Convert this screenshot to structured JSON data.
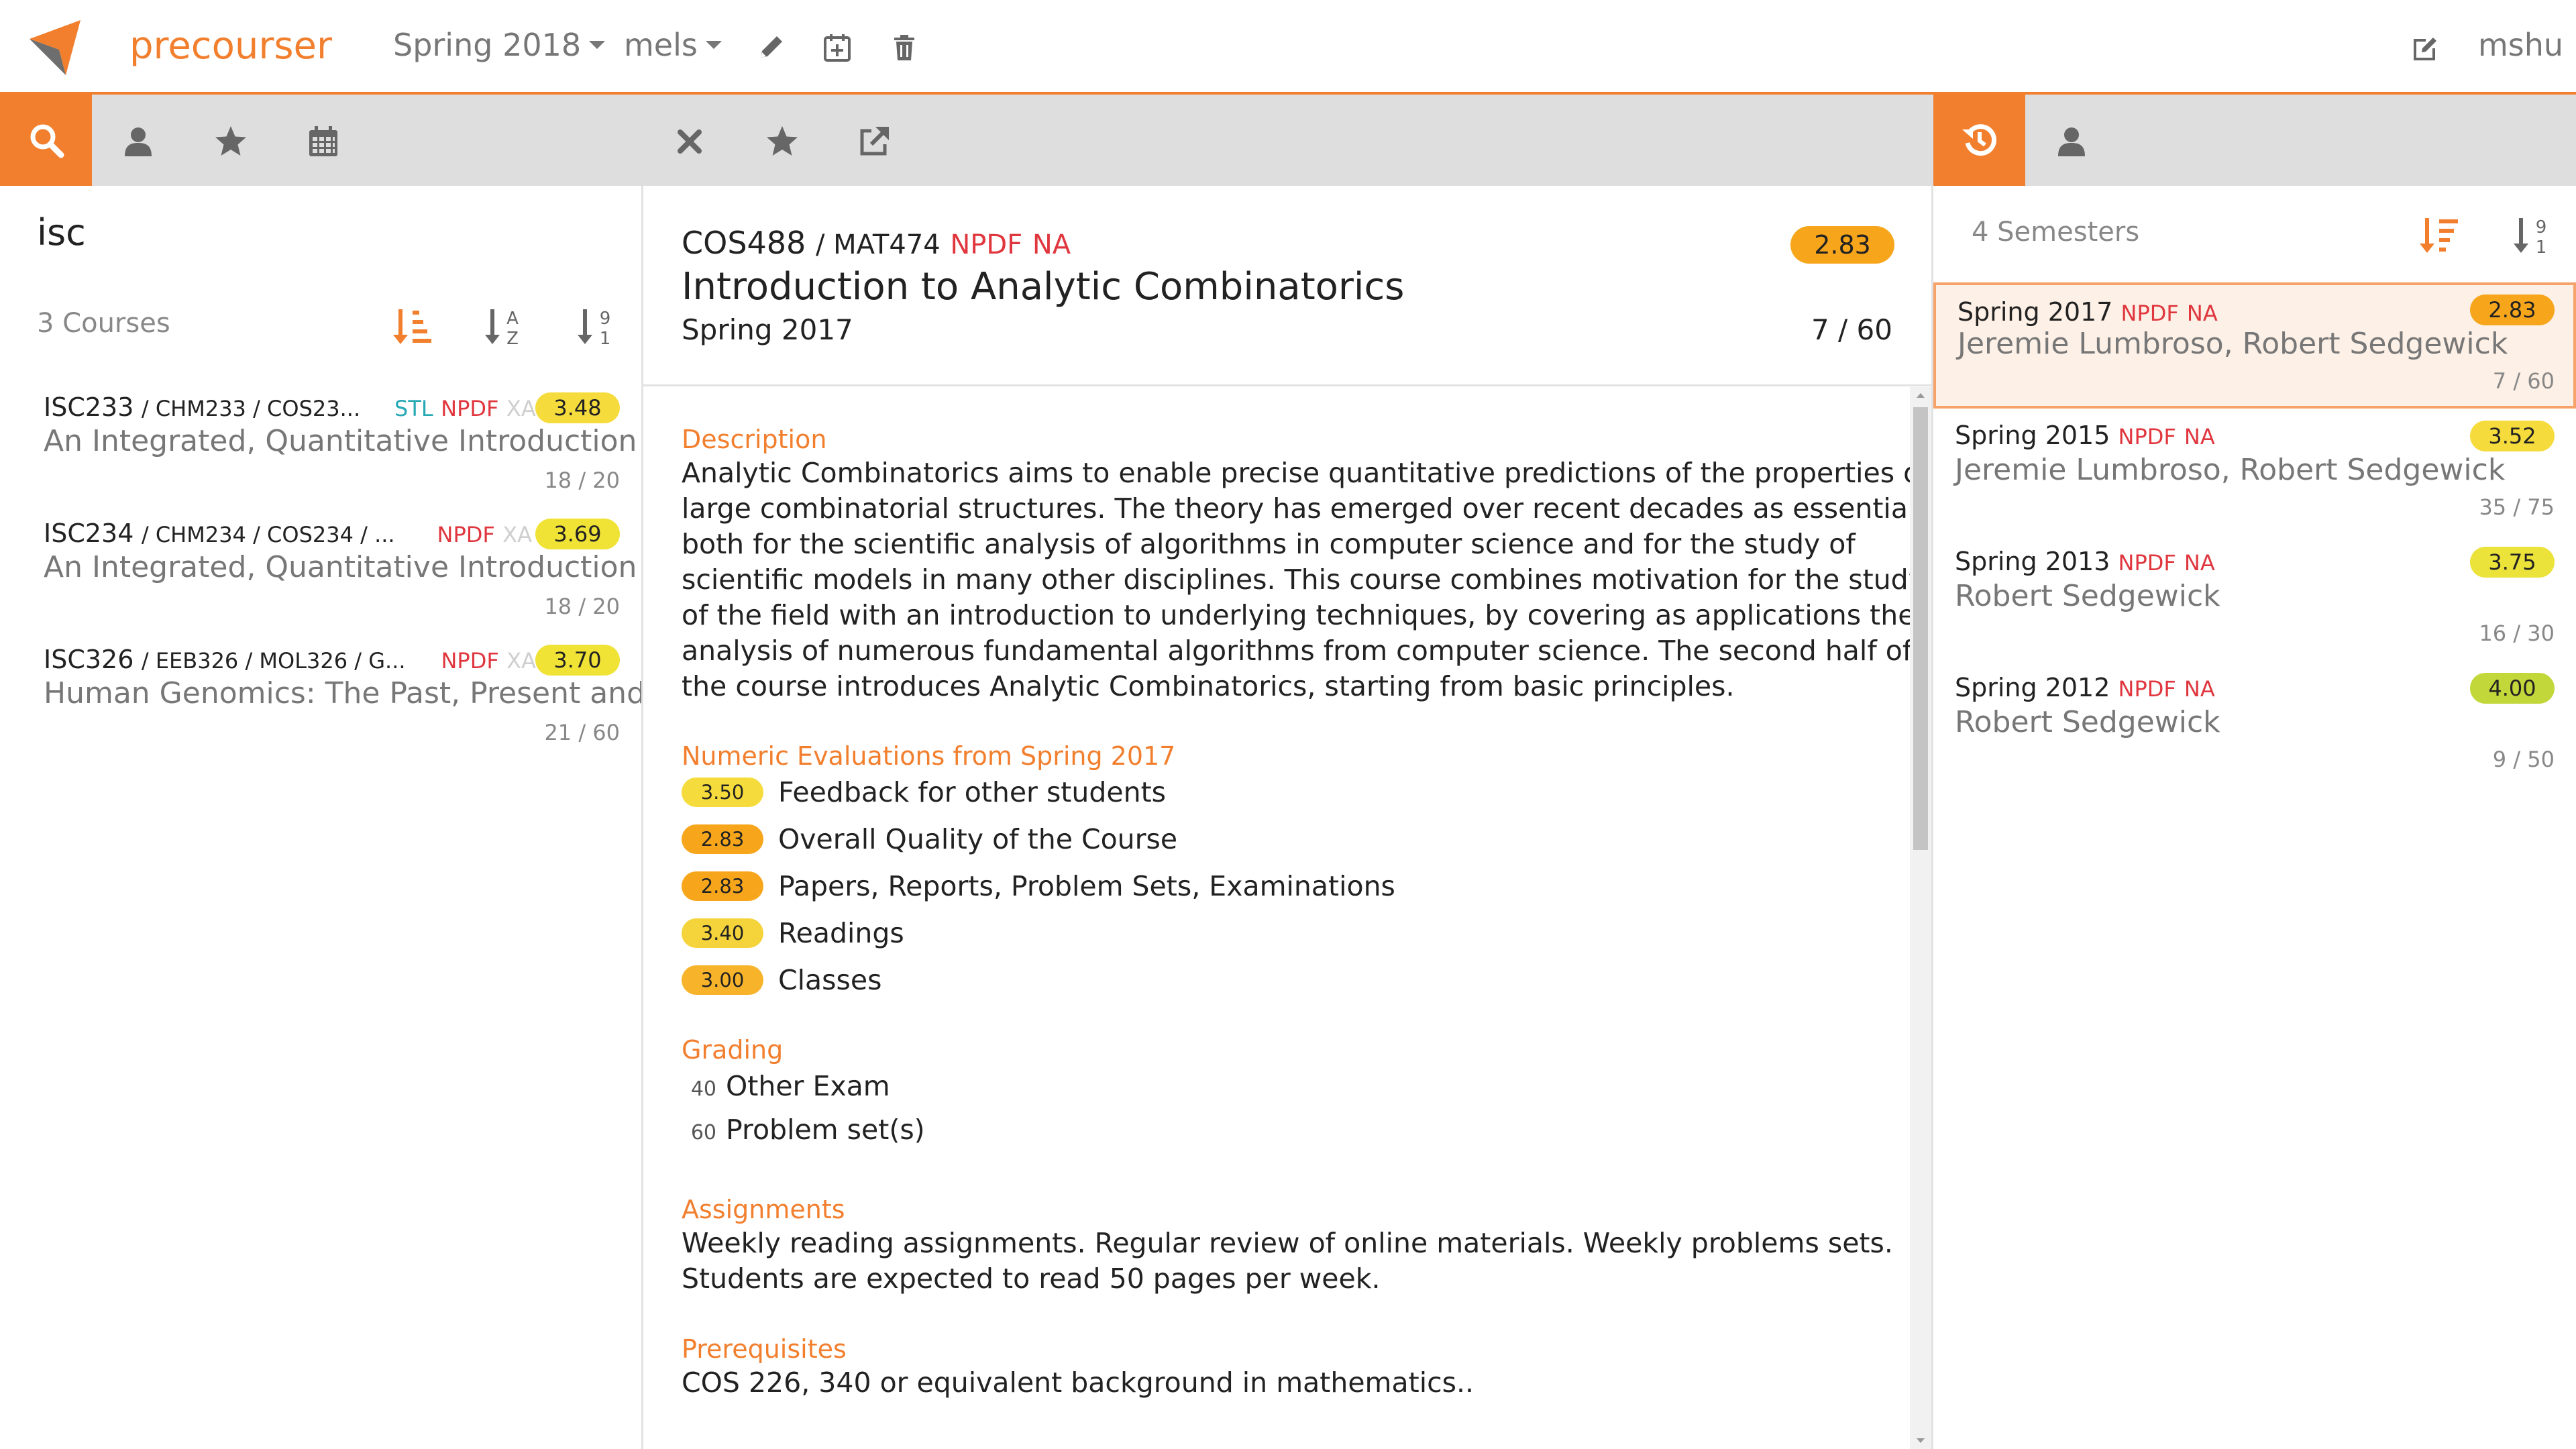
{
  "app": {
    "brand": "precourser"
  },
  "nav": {
    "semester": "Spring 2018",
    "user_list": "mels",
    "username": "mshu"
  },
  "colors": {
    "accent": "#f27f2e",
    "red": "#e0363e",
    "teal": "#27a9b5"
  },
  "search": {
    "query": "isc",
    "count_label": "3 Courses"
  },
  "courses": [
    {
      "code": "ISC233",
      "crosslist": "/ CHM233  / COS23...",
      "tags": [
        "STL",
        "NPDF",
        "XA"
      ],
      "rating": "3.48",
      "rating_color": "#f5dc3c",
      "title": "An Integrated, Quantitative Introduction",
      "count": "18 / 20"
    },
    {
      "code": "ISC234",
      "crosslist": "/ CHM234  / COS234  / ...",
      "tags": [
        "NPDF",
        "XA"
      ],
      "rating": "3.69",
      "rating_color": "#f0e336",
      "title": "An Integrated, Quantitative Introduction",
      "count": "18 / 20"
    },
    {
      "code": "ISC326",
      "crosslist": "/ EEB326  / MOL326  / G...",
      "tags": [
        "NPDF",
        "XA"
      ],
      "rating": "3.70",
      "rating_color": "#f0e336",
      "title": "Human Genomics: The Past, Present and",
      "count": "21 / 60"
    }
  ],
  "detail": {
    "code": "COS488",
    "crosslist": "/ MAT474",
    "tags": [
      "NPDF",
      "NA"
    ],
    "rating": "2.83",
    "title": "Introduction to Analytic Combinatorics",
    "term": "Spring 2017",
    "enrollment": "7 / 60",
    "description_heading": "Description",
    "description": [
      "Analytic Combinatorics aims to enable precise quantitative predictions of the properties of",
      "large combinatorial structures. The theory has emerged over recent decades as essential",
      "both for the scientific analysis of algorithms in computer science and for the study of",
      "scientific models in many other disciplines. This course combines motivation for the study",
      "of the field with an introduction to underlying techniques, by covering as applications the",
      "analysis of numerous fundamental algorithms from computer science. The second half of",
      "the course introduces Analytic Combinatorics, starting from basic principles."
    ],
    "evals_heading": "Numeric Evaluations from Spring 2017",
    "evals": [
      {
        "score": "3.50",
        "color": "#f5dc3c",
        "label": "Feedback for other students"
      },
      {
        "score": "2.83",
        "color": "#f7a61c",
        "label": "Overall Quality of the Course"
      },
      {
        "score": "2.83",
        "color": "#f7a61c",
        "label": "Papers, Reports, Problem Sets, Examinations"
      },
      {
        "score": "3.40",
        "color": "#f5d33a",
        "label": "Readings"
      },
      {
        "score": "3.00",
        "color": "#f7b42a",
        "label": "Classes"
      }
    ],
    "grading_heading": "Grading",
    "grading": [
      {
        "pct": "40",
        "label": "Other Exam"
      },
      {
        "pct": "60",
        "label": "Problem set(s)"
      }
    ],
    "assignments_heading": "Assignments",
    "assignments": [
      "Weekly reading assignments. Regular review of online materials. Weekly problems sets.",
      "Students are expected to read 50 pages per week."
    ],
    "prereq_heading": "Prerequisites",
    "prereq": "COS 226, 340 or equivalent background in mathematics.."
  },
  "semesters": {
    "count_label": "4 Semesters",
    "items": [
      {
        "term": "Spring 2017",
        "tags": [
          "NPDF",
          "NA"
        ],
        "rating": "2.83",
        "rating_color": "#f7a61c",
        "prof": "Jeremie Lumbroso, Robert Sedgewick",
        "count": "7 / 60",
        "selected": true
      },
      {
        "term": "Spring 2015",
        "tags": [
          "NPDF",
          "NA"
        ],
        "rating": "3.52",
        "rating_color": "#f5dc3c",
        "prof": "Jeremie Lumbroso, Robert Sedgewick",
        "count": "35 / 75",
        "selected": false
      },
      {
        "term": "Spring 2013",
        "tags": [
          "NPDF",
          "NA"
        ],
        "rating": "3.75",
        "rating_color": "#ebe23a",
        "prof": "Robert Sedgewick",
        "count": "16 / 30",
        "selected": false
      },
      {
        "term": "Spring 2012",
        "tags": [
          "NPDF",
          "NA"
        ],
        "rating": "4.00",
        "rating_color": "#c2d73a",
        "prof": "Robert Sedgewick",
        "count": "9 / 50",
        "selected": false
      }
    ]
  }
}
